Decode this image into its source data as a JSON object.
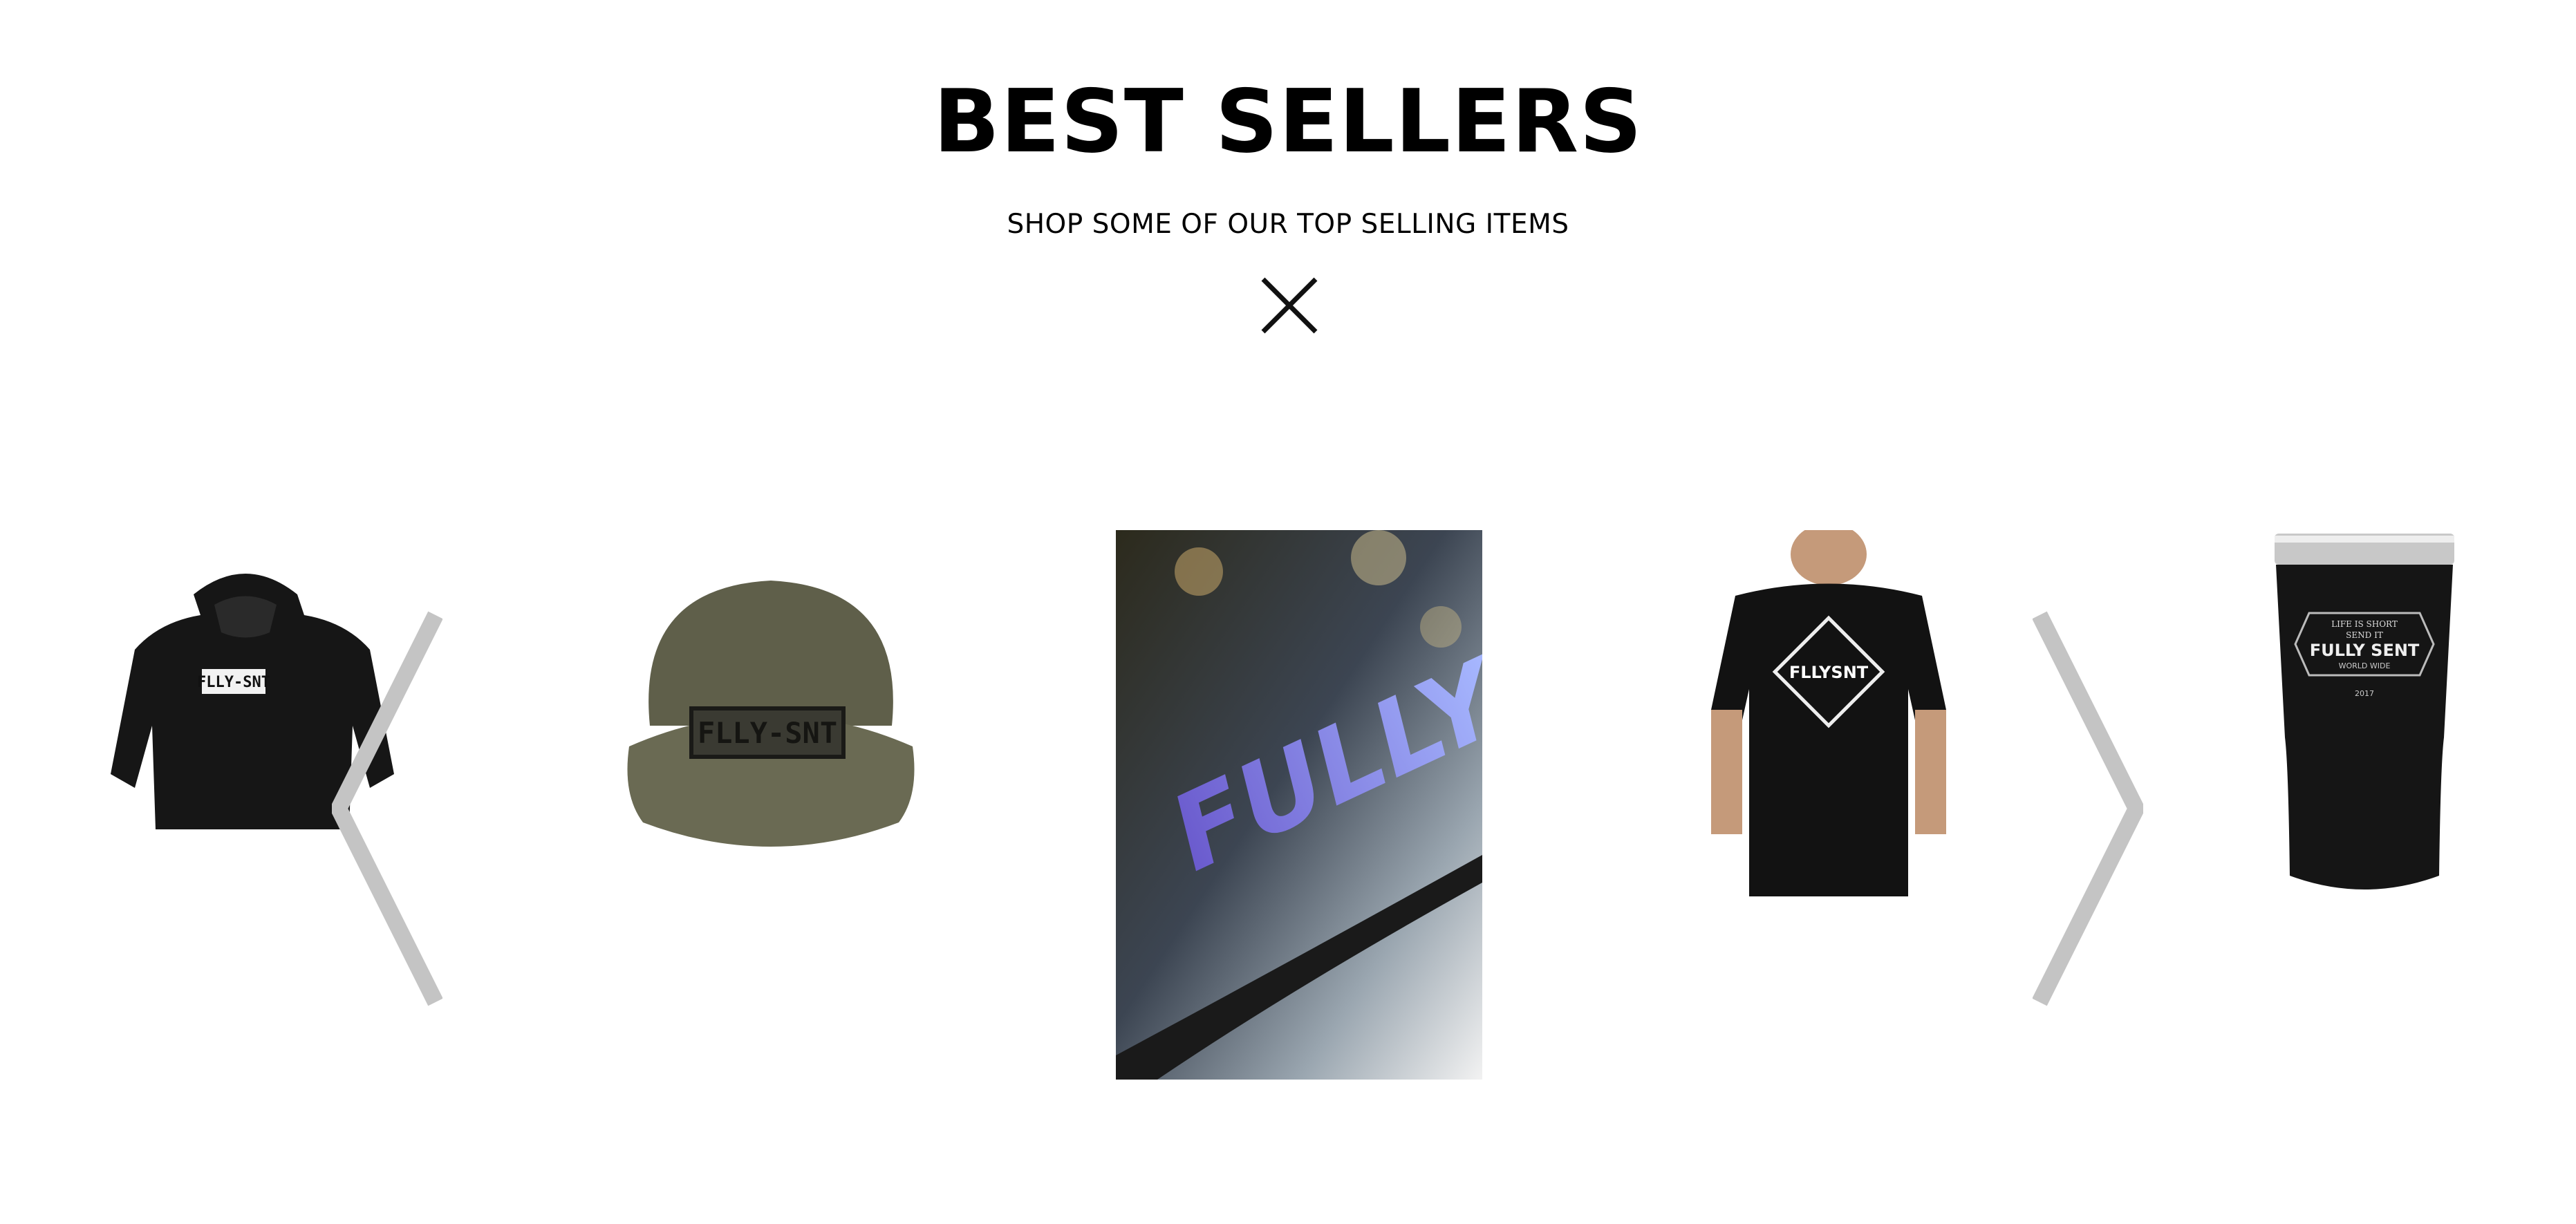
{
  "section": {
    "title": "BEST SELLERS",
    "subtitle": "SHOP SOME OF OUR TOP SELLING ITEMS",
    "divider_icon": "close-x-icon"
  },
  "carousel": {
    "prev_icon": "chevron-left-icon",
    "next_icon": "chevron-right-icon",
    "arrow_color": "#c4c4c4",
    "products": [
      {
        "name": "hoodie",
        "print": "FLLY-SNT"
      },
      {
        "name": "five-panel-hat",
        "print": "FLLY-SNT"
      },
      {
        "name": "decal-poster",
        "print": "FULLY"
      },
      {
        "name": "t-shirt",
        "print": "FLLYSNT"
      },
      {
        "name": "tumbler",
        "print_top": "LIFE IS SHORT",
        "print_mid": "SEND IT",
        "print_main": "FULLY SENT",
        "print_sub": "WORLD WIDE",
        "print_year": "2017"
      }
    ]
  }
}
